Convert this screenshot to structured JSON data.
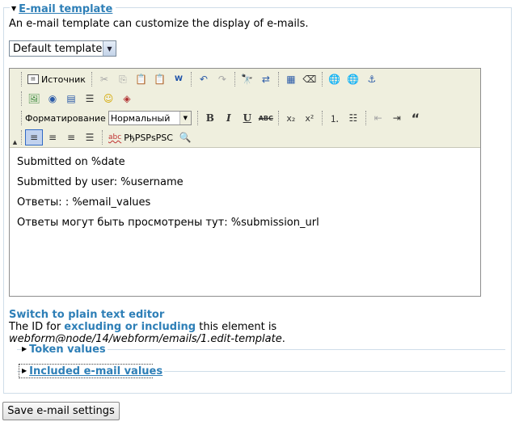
{
  "fieldset": {
    "title": "E-mail template",
    "description": "An e-mail template can customize the display of e-mails."
  },
  "template_select": {
    "value": "Default template"
  },
  "toolbar": {
    "source_label": "Источник",
    "format_label": "Форматирование",
    "format_value": "Нормальный",
    "spellcheck_label": "РђРЅРѕРЅС",
    "icons": {
      "row1": [
        "source-icon",
        "cut-icon",
        "copy-icon",
        "paste-icon",
        "paste-text-icon",
        "paste-word-icon",
        "undo-icon",
        "redo-icon",
        "find-icon",
        "replace-icon",
        "select-all-icon",
        "remove-format-icon",
        "link-icon",
        "unlink-icon",
        "anchor-icon"
      ],
      "row2": [
        "image-icon",
        "flash-icon",
        "table-icon",
        "horizontal-rule-icon",
        "smiley-icon",
        "special-char-icon"
      ],
      "row3": [
        "bold-icon",
        "italic-icon",
        "underline-icon",
        "strike-icon",
        "subscript-icon",
        "superscript-icon",
        "ordered-list-icon",
        "bulleted-list-icon",
        "outdent-icon",
        "indent-icon",
        "blockquote-icon"
      ],
      "row4": [
        "align-left-icon",
        "align-center-icon",
        "align-right-icon",
        "justify-icon",
        "spellcheck-icon",
        "preview-icon"
      ]
    }
  },
  "editor_content": {
    "line1": "Submitted on %date",
    "line2": "Submitted by user: %username",
    "line3": "Ответы: : %email_values",
    "line4": "Ответы могут быть просмотрены тут: %submission_url"
  },
  "switch_link": "Switch to plain text editor",
  "id_note": {
    "prefix": "The ID for ",
    "bold": "excluding or including",
    "middle": " this element is ",
    "id": "webform@node/14/webform/emails/1.edit-template",
    "suffix": "."
  },
  "subsections": {
    "token_values": "Token values",
    "included_values": "Included e-mail values"
  },
  "save_button": "Save e-mail settings",
  "colors": {
    "link": "#2e7fb7",
    "toolbar_bg": "#efefde",
    "fieldset_border": "#cfdde9"
  }
}
